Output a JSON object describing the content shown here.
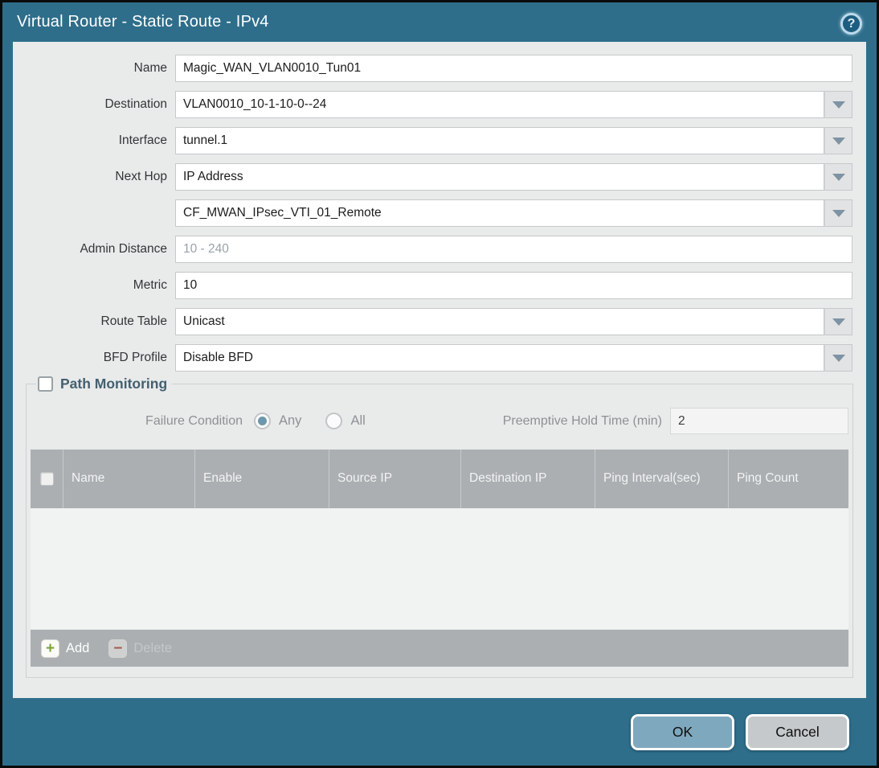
{
  "title_bar": {
    "title": "Virtual Router - Static Route - IPv4",
    "help_glyph": "?"
  },
  "form": {
    "rows": [
      {
        "label": "Name",
        "value": "Magic_WAN_VLAN0010_Tun01",
        "placeholder": "",
        "type": "text"
      },
      {
        "label": "Destination",
        "value": "VLAN0010_10-1-10-0--24",
        "placeholder": "",
        "type": "dropdown"
      },
      {
        "label": "Interface",
        "value": "tunnel.1",
        "placeholder": "",
        "type": "dropdown"
      },
      {
        "label": "Next Hop",
        "value": "IP Address",
        "placeholder": "",
        "type": "dropdown"
      },
      {
        "label": "",
        "value": "CF_MWAN_IPsec_VTI_01_Remote",
        "placeholder": "",
        "type": "dropdown"
      },
      {
        "label": "Admin Distance",
        "value": "",
        "placeholder": "10 - 240",
        "type": "text"
      },
      {
        "label": "Metric",
        "value": "10",
        "placeholder": "",
        "type": "text"
      },
      {
        "label": "Route Table",
        "value": "Unicast",
        "placeholder": "",
        "type": "dropdown"
      },
      {
        "label": "BFD Profile",
        "value": "Disable BFD",
        "placeholder": "",
        "type": "dropdown"
      }
    ]
  },
  "path_monitoring": {
    "legend": "Path Monitoring",
    "enabled": false,
    "failure_condition": {
      "label": "Failure Condition",
      "options": [
        {
          "label": "Any",
          "selected": true
        },
        {
          "label": "All",
          "selected": false
        }
      ]
    },
    "preemptive_hold_time": {
      "label": "Preemptive Hold Time (min)",
      "value": "2"
    },
    "table": {
      "columns": [
        "Name",
        "Enable",
        "Source IP",
        "Destination IP",
        "Ping Interval(sec)",
        "Ping Count"
      ],
      "rows": []
    },
    "toolbar": {
      "add_label": "Add",
      "delete_label": "Delete"
    }
  },
  "footer": {
    "ok_label": "OK",
    "cancel_label": "Cancel"
  },
  "colors": {
    "frame_teal": "#2E6E8B",
    "content_gray": "#E9EAEA",
    "table_header_gray": "#ABAFB1",
    "legend_text": "#44606F",
    "ok_button": "#7EA8BD",
    "cancel_button": "#C6C9CB",
    "add_plus": "#7DA33C",
    "delete_minus": "#A65C50",
    "radio_selected": "#6D98AB"
  }
}
